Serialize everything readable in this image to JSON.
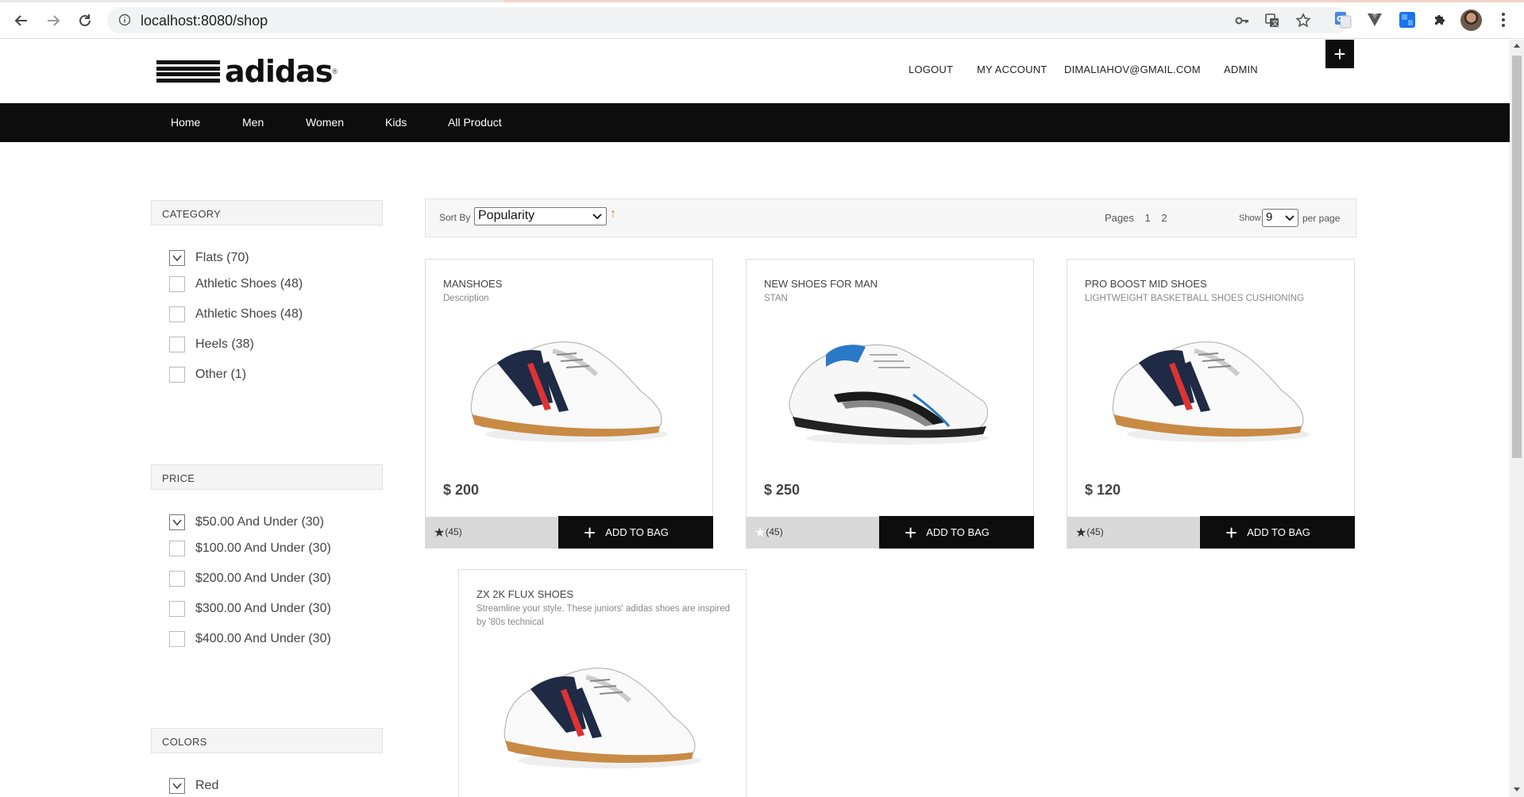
{
  "browser": {
    "url": "localhost:8080/shop"
  },
  "header": {
    "logo_text": "adidas",
    "links": [
      "LOGOUT",
      "MY ACCOUNT",
      "DIMALIAHOV@GMAIL.COM",
      "ADMIN"
    ],
    "plus_label": "+"
  },
  "nav": {
    "items": [
      "Home",
      "Men",
      "Women",
      "Kids",
      "All Product"
    ]
  },
  "sidebar": {
    "category": {
      "title": "CATEGORY",
      "items": [
        {
          "label": "Flats (70)",
          "checked": true
        },
        {
          "label": "Athletic Shoes (48)",
          "checked": false
        },
        {
          "label": "Athletic Shoes (48)",
          "checked": false
        },
        {
          "label": "Heels (38)",
          "checked": false
        },
        {
          "label": "Other (1)",
          "checked": false
        }
      ]
    },
    "price": {
      "title": "PRICE",
      "items": [
        {
          "label": "$50.00 And Under (30)",
          "checked": true
        },
        {
          "label": "$100.00 And Under (30)",
          "checked": false
        },
        {
          "label": "$200.00 And Under (30)",
          "checked": false
        },
        {
          "label": "$300.00 And Under (30)",
          "checked": false
        },
        {
          "label": "$400.00 And Under (30)",
          "checked": false
        }
      ]
    },
    "colors": {
      "title": "COLORS",
      "items": [
        {
          "label": "Red",
          "checked": true
        }
      ]
    }
  },
  "toolbar": {
    "sort_label": "Sort By",
    "sort_value": "Popularity",
    "sort_direction_icon": "↑",
    "pages_label": "Pages",
    "pages": [
      "1",
      "2"
    ],
    "show_label": "Show",
    "show_value": "9",
    "per_page_label": "per page"
  },
  "products": [
    {
      "name": "MANSHOES",
      "description": "Description",
      "price": "$ 200",
      "rating_count": "(45)",
      "star": "filled",
      "add_label": "ADD TO BAG",
      "shoe": "navy-red"
    },
    {
      "name": "NEW SHOES FOR MAN",
      "description": "STAN",
      "price": "$ 250",
      "rating_count": "(45)",
      "star": "empty",
      "add_label": "ADD TO BAG",
      "shoe": "black-blue"
    },
    {
      "name": "PRO BOOST MID SHOES",
      "description": "LIGHTWEIGHT BASKETBALL SHOES CUSHIONING",
      "price": "$ 120",
      "rating_count": "(45)",
      "star": "filled",
      "add_label": "ADD TO BAG",
      "shoe": "navy-red"
    },
    {
      "name": "ZX 2K FLUX SHOES",
      "description": "Streamline your style. These juniors' adidas shoes are inspired by '80s technical",
      "price": "",
      "rating_count": "",
      "star": "",
      "add_label": "",
      "shoe": "navy-red"
    }
  ],
  "colors": {
    "nav_bg": "#0d0d0d",
    "accent_arrow": "#e07a1f",
    "rating_bg": "#d9d9d9"
  }
}
